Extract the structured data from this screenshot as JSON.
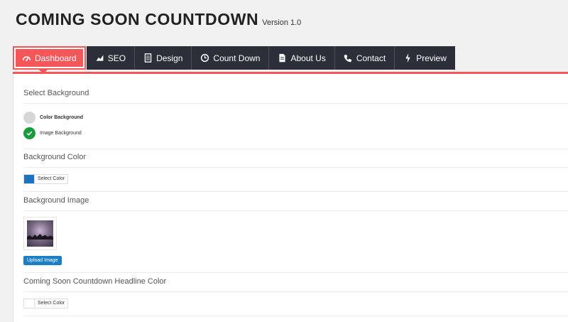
{
  "header": {
    "title": "COMING SOON COUNTDOWN",
    "version": "Version 1.0"
  },
  "nav": {
    "tabs": [
      {
        "label": "Dashboard",
        "icon": "dashboard-icon"
      },
      {
        "label": "SEO",
        "icon": "chart-icon"
      },
      {
        "label": "Design",
        "icon": "document-icon"
      },
      {
        "label": "Count Down",
        "icon": "clock-icon"
      },
      {
        "label": "About Us",
        "icon": "file-icon"
      },
      {
        "label": "Contact",
        "icon": "phone-icon"
      },
      {
        "label": "Preview",
        "icon": "bolt-icon"
      }
    ]
  },
  "background": {
    "title": "Select Background",
    "options": [
      {
        "label": "Color Background",
        "checked": false
      },
      {
        "label": "Image Background",
        "checked": true
      }
    ]
  },
  "bg_color": {
    "title": "Background Color",
    "button": "Select Color",
    "color": "#1e73be"
  },
  "bg_image": {
    "title": "Background Image",
    "upload_label": "Upload Image"
  },
  "headline_color": {
    "title": "Coming Soon Countdown Headline Color",
    "button": "Select Color",
    "color": "#ffffff"
  },
  "colors": {
    "accent": "#f3575a",
    "nav_bg": "#2b2f3a",
    "success": "#1a9b3a",
    "primary": "#1a7fc4"
  }
}
